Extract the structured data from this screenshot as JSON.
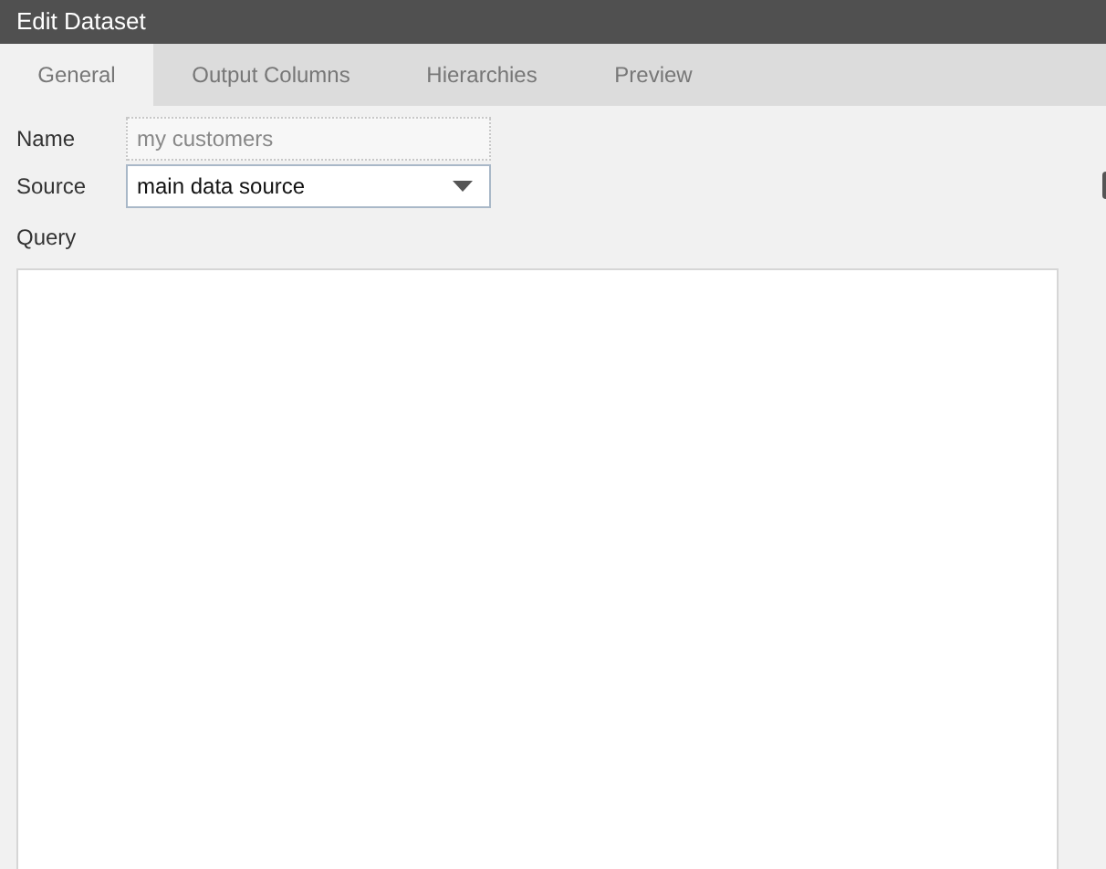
{
  "window": {
    "title": "Edit Dataset"
  },
  "tabs": [
    {
      "label": "General",
      "selected": true
    },
    {
      "label": "Output Columns",
      "selected": false
    },
    {
      "label": "Hierarchies",
      "selected": false
    },
    {
      "label": "Preview",
      "selected": false
    }
  ],
  "form": {
    "name": {
      "label": "Name",
      "value": "my customers"
    },
    "source": {
      "label": "Source",
      "value": "main data source"
    },
    "query": {
      "label": "Query"
    }
  }
}
